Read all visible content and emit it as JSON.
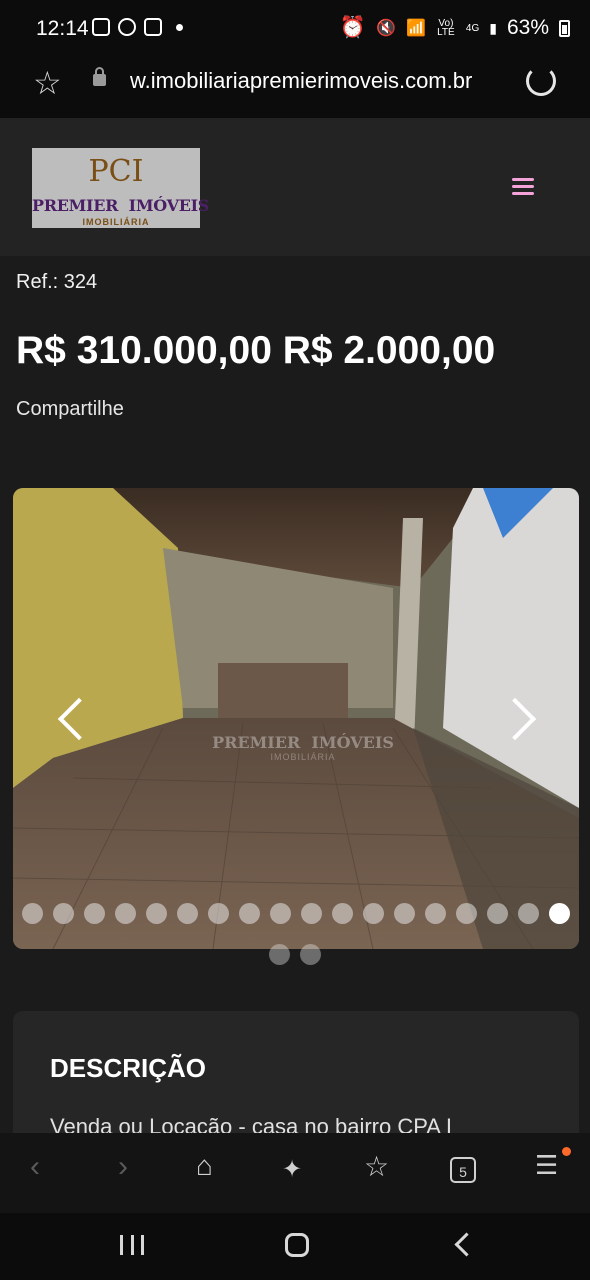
{
  "status_bar": {
    "time": "12:14",
    "battery": "63%",
    "network_label": "Vo) LTE",
    "signal_label": "4G",
    "notification_icons": [
      "image-icon",
      "whatsapp-icon",
      "checkbox-icon",
      "dot-icon"
    ],
    "system_icons": [
      "alarm-icon",
      "mute-icon",
      "wifi-icon",
      "signal-icon",
      "battery-icon"
    ]
  },
  "browser": {
    "url": "w.imobiliariapremierimoveis.com.br",
    "favorite_icon": "star-icon",
    "lock_icon": "lock-icon",
    "reload_icon": "reload-icon"
  },
  "site_header": {
    "logo_mark": "PCI",
    "logo_name": "PREMIER  IMÓVEIS",
    "logo_sub": "IMOBILIÁRIA",
    "menu_icon": "hamburger-icon",
    "accent_color": "#f4a3d8"
  },
  "listing": {
    "ref": "Ref.: 324",
    "price": "R$ 310.000,00 R$ 2.000,00",
    "share": "Compartilhe"
  },
  "gallery": {
    "photo_count": 20,
    "active_index": 18,
    "watermark": "PREMIER  IMÓVEIS",
    "watermark_sub": "IMOBILIÁRIA"
  },
  "description": {
    "title": "DESCRIÇÃO",
    "text": "Venda ou Locação - casa no bairro CPA I"
  },
  "bottom_nav": {
    "tabs_count": "5",
    "items": [
      "back-icon",
      "forward-icon",
      "home-icon",
      "sparkle-icon",
      "bookmarks-icon",
      "tabs-icon",
      "menu-icon"
    ]
  }
}
